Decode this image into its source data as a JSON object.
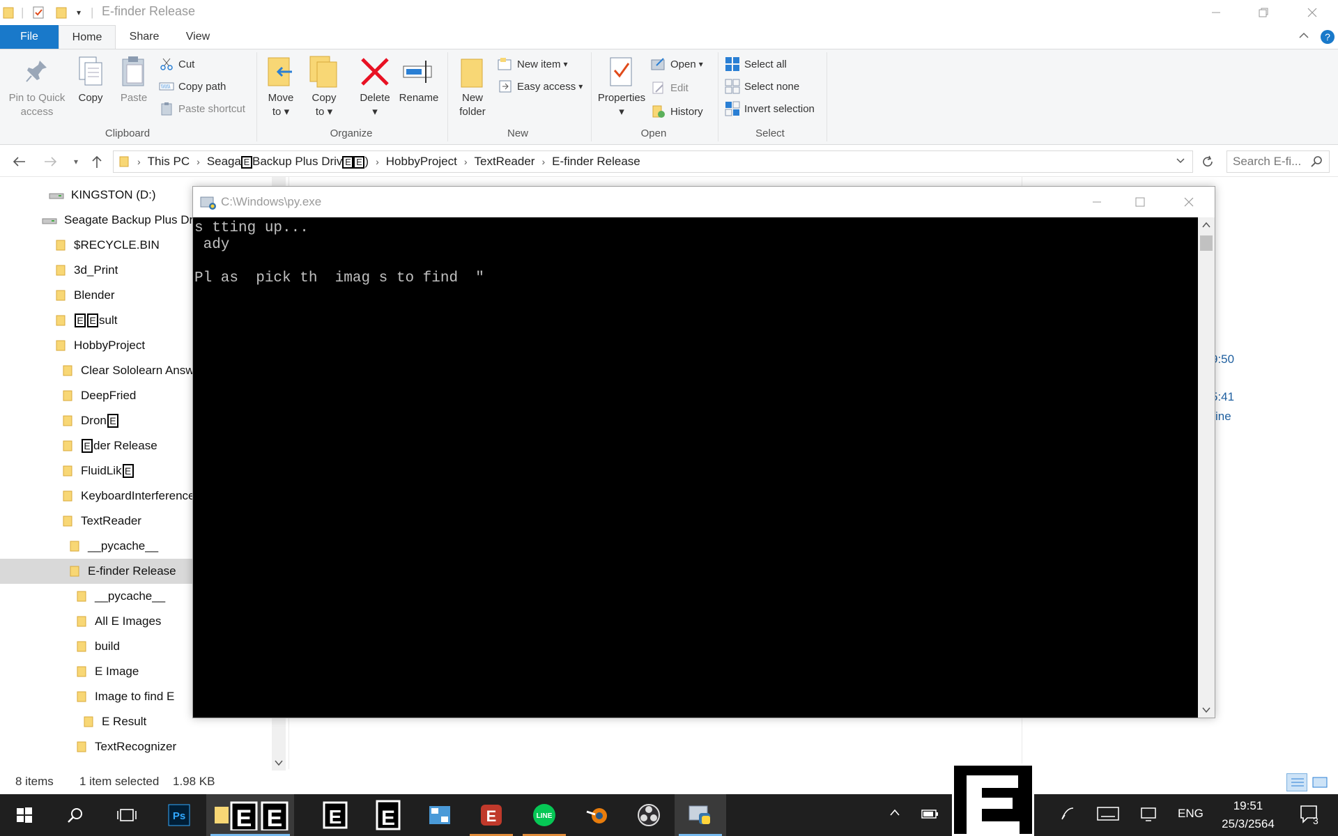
{
  "window": {
    "title": "E-finder Release"
  },
  "ribbon": {
    "tabs": [
      "File",
      "Home",
      "Share",
      "View"
    ],
    "clipboard": {
      "pin_label_1": "Pin to Quick",
      "pin_label_2": "access",
      "copy": "Copy",
      "paste": "Paste",
      "cut": "Cut",
      "copy_path": "Copy path",
      "paste_shortcut": "Paste shortcut",
      "group": "Clipboard"
    },
    "organize": {
      "move_1": "Move",
      "move_2": "to",
      "copy_1": "Copy",
      "copy_2": "to",
      "delete": "Delete",
      "rename": "Rename",
      "group": "Organize"
    },
    "new": {
      "folder_1": "New",
      "folder_2": "folder",
      "new_item": "New item",
      "easy_access": "Easy access",
      "group": "New"
    },
    "open": {
      "properties": "Properties",
      "open": "Open",
      "edit": "Edit",
      "history": "History",
      "group": "Open"
    },
    "select": {
      "select_all": "Select all",
      "select_none": "Select none",
      "invert": "Invert selection",
      "group": "Select"
    }
  },
  "address": {
    "crumbs": [
      "This PC",
      "Seaga",
      "Backup Plus Driv",
      ")",
      "HobbyProject",
      "TextReader",
      "E-finder Release"
    ],
    "search_placeholder": "Search E-fi..."
  },
  "navpane": {
    "items": [
      {
        "label": "KINGSTON (D:)",
        "type": "drive"
      },
      {
        "label": "Seagate Backup Plus Dr",
        "type": "drive"
      },
      {
        "label": "$RECYCLE.BIN",
        "type": "folder"
      },
      {
        "label": "3d_Print",
        "type": "folder"
      },
      {
        "label": "Blender",
        "type": "folder"
      },
      {
        "label": "sult",
        "type": "folder"
      },
      {
        "label": "HobbyProject",
        "type": "folder"
      },
      {
        "label": "Clear Sololearn Answ",
        "type": "folder"
      },
      {
        "label": "DeepFried",
        "type": "folder"
      },
      {
        "label": "Dron",
        "type": "folder"
      },
      {
        "label": "der Release",
        "type": "folder"
      },
      {
        "label": "FluidLik",
        "type": "folder"
      },
      {
        "label": "KeyboardInterference",
        "type": "folder"
      },
      {
        "label": "TextReader",
        "type": "folder"
      },
      {
        "label": "__pycache__",
        "type": "folder"
      },
      {
        "label": "E-finder Release",
        "type": "folder"
      },
      {
        "label": "__pycache__",
        "type": "folder"
      },
      {
        "label": "All E Images",
        "type": "folder"
      },
      {
        "label": "build",
        "type": "folder"
      },
      {
        "label": "E Image",
        "type": "folder"
      },
      {
        "label": "Image to find E",
        "type": "folder"
      },
      {
        "label": "E Result",
        "type": "folder"
      },
      {
        "label": "TextRecognizer",
        "type": "folder"
      }
    ]
  },
  "background": {
    "time1": "9:50",
    "time2": "5:41",
    "text3": "ine"
  },
  "status": {
    "items": "8 items",
    "selected": "1 item selected",
    "size": "1.98 KB"
  },
  "console": {
    "title": "C:\\Windows\\py.exe",
    "lines": [
      "s tting up...",
      " ady",
      "",
      "Pl as  pick th  imag s to find  \""
    ]
  },
  "taskbar": {
    "lang": "ENG",
    "time": "19:51",
    "date": "25/3/2564",
    "notif_count": "3"
  },
  "colors": {
    "accent": "#1979ca",
    "folder": "#f8d775",
    "delete_red": "#e81123",
    "taskbar": "#1f1f1f"
  }
}
